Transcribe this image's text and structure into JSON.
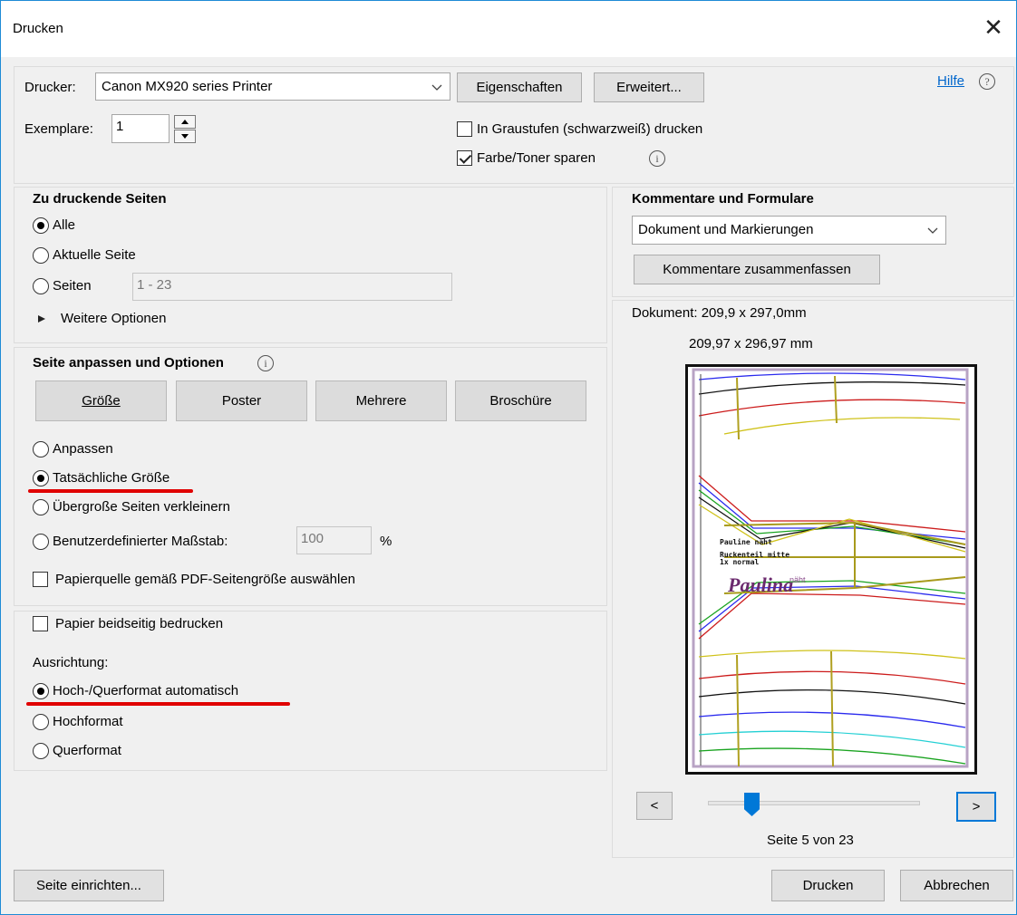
{
  "window": {
    "title": "Drucken",
    "close_icon": "close-icon"
  },
  "printer": {
    "label": "Drucker:",
    "selected": "Canon MX920 series Printer",
    "properties_button": "Eigenschaften",
    "advanced_button": "Erweitert...",
    "help_link": "Hilfe",
    "copies_label": "Exemplare:",
    "copies_value": "1",
    "grayscale_label": "In Graustufen (schwarzweiß) drucken",
    "grayscale_checked": false,
    "save_toner_label": "Farbe/Toner sparen",
    "save_toner_checked": true
  },
  "pages": {
    "heading": "Zu druckende Seiten",
    "options": [
      {
        "label": "Alle",
        "selected": true
      },
      {
        "label": "Aktuelle Seite",
        "selected": false
      },
      {
        "label": "Seiten",
        "selected": false
      }
    ],
    "range_value": "1 - 23",
    "more_options": "Weitere Optionen"
  },
  "fit": {
    "heading": "Seite anpassen und Optionen",
    "tabs": [
      "Größe",
      "Poster",
      "Mehrere",
      "Broschüre"
    ],
    "options": [
      {
        "label": "Anpassen",
        "selected": false
      },
      {
        "label": "Tatsächliche Größe",
        "selected": true
      },
      {
        "label": "Übergroße Seiten verkleinern",
        "selected": false
      },
      {
        "label": "Benutzerdefinierter Maßstab:",
        "selected": false
      }
    ],
    "scale_value": "100",
    "scale_unit": "%",
    "paper_source_label": "Papierquelle gemäß PDF-Seitengröße auswählen"
  },
  "duplex": {
    "label": "Papier beidseitig bedrucken",
    "orientation_heading": "Ausrichtung:",
    "options": [
      {
        "label": "Hoch-/Querformat automatisch",
        "selected": true
      },
      {
        "label": "Hochformat",
        "selected": false
      },
      {
        "label": "Querformat",
        "selected": false
      }
    ]
  },
  "comments": {
    "heading": "Kommentare und Formulare",
    "selected": "Dokument und Markierungen",
    "summarize_button": "Kommentare zusammenfassen"
  },
  "preview": {
    "document_size": "Dokument: 209,9 x 297,0mm",
    "page_size": "209,97 x 296,97 mm",
    "page_text_1": "Pauline naht",
    "page_text_2": "Ruckenteil mitte",
    "page_text_3": "1x normal",
    "logo_text": "Paulina",
    "logo_suffix": "näht",
    "prev_button": "<",
    "next_button": ">",
    "page_indicator": "Seite 5 von 23",
    "current_page": 5,
    "total_pages": 23
  },
  "footer": {
    "page_setup_button": "Seite einrichten...",
    "print_button": "Drucken",
    "cancel_button": "Abbrechen"
  },
  "colors": {
    "accent": "#0078d7",
    "annotation_red": "#e00000"
  }
}
